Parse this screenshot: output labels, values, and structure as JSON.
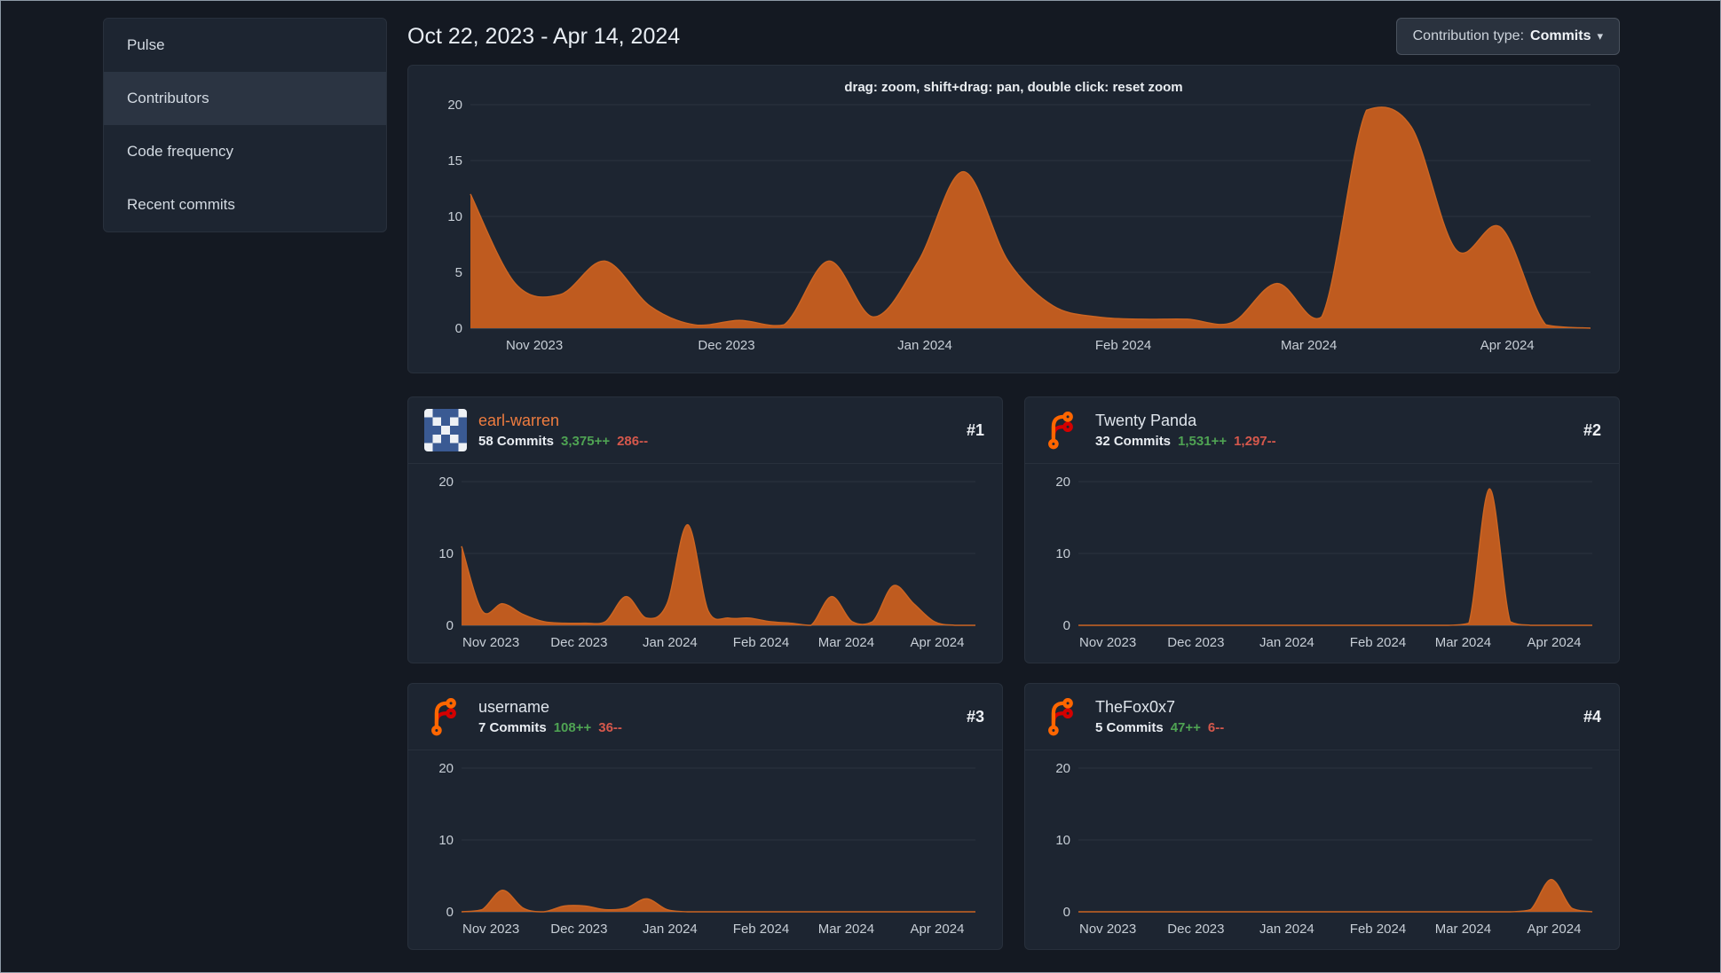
{
  "colors": {
    "chart_fill": "#bf5b1f",
    "additions_green": "#4fa353",
    "deletions_red": "#d5584c",
    "link_orange": "#ee7c3f"
  },
  "sidebar": {
    "active": "Contributors",
    "items": [
      {
        "label": "Pulse"
      },
      {
        "label": "Contributors"
      },
      {
        "label": "Code frequency"
      },
      {
        "label": "Recent commits"
      }
    ]
  },
  "header": {
    "date_range": "Oct 22, 2023 - Apr 14, 2024",
    "contribution_type_label": "Contribution type:",
    "contribution_type_value": "Commits"
  },
  "main_chart": {
    "hint": "drag: zoom, shift+drag: pan, double click: reset zoom"
  },
  "contributors": [
    {
      "name": "earl-warren",
      "name_style": "color:#ee7c3f",
      "rank": "#1",
      "commits": "58 Commits",
      "additions": "3,375++",
      "deletions": "286--",
      "avatar": "identicon"
    },
    {
      "name": "Twenty Panda",
      "rank": "#2",
      "commits": "32 Commits",
      "additions": "1,531++",
      "deletions": "1,297--",
      "avatar": "forgejo-logo"
    },
    {
      "name": "username",
      "rank": "#3",
      "commits": "7 Commits",
      "additions": "108++",
      "deletions": "36--",
      "avatar": "forgejo-logo"
    },
    {
      "name": "TheFox0x7",
      "rank": "#4",
      "commits": "5 Commits",
      "additions": "47++",
      "deletions": "6--",
      "avatar": "forgejo-logo"
    }
  ],
  "chart_data": {
    "type": "area",
    "x_range": [
      "Oct 22, 2023",
      "Apr 14, 2024"
    ],
    "x_interval": "week",
    "x_month_labels": [
      "Nov 2023",
      "Dec 2023",
      "Jan 2024",
      "Feb 2024",
      "Mar 2024",
      "Apr 2024"
    ],
    "ylim": [
      0,
      20
    ],
    "color": "#bf5b1f",
    "main": {
      "yticks": [
        0,
        5,
        10,
        15,
        20
      ],
      "values": [
        12,
        4,
        3,
        6,
        2,
        0.3,
        0.7,
        0.3,
        6,
        1,
        6,
        14,
        6,
        2,
        1,
        0.8,
        0.8,
        0.5,
        4,
        1,
        19.5,
        18,
        7,
        9,
        0.3,
        0
      ]
    },
    "per_contributor": [
      {
        "name": "earl-warren",
        "yticks": [
          0,
          10,
          20
        ],
        "values": [
          11,
          2,
          3,
          1.5,
          0.5,
          0.3,
          0.3,
          0.5,
          4,
          1,
          3,
          14,
          2,
          1,
          1,
          0.5,
          0.3,
          0,
          4,
          0.5,
          0.5,
          5.5,
          3,
          0.5,
          0,
          0
        ]
      },
      {
        "name": "Twenty Panda",
        "yticks": [
          0,
          10,
          20
        ],
        "values": [
          0,
          0,
          0,
          0,
          0,
          0,
          0,
          0,
          0,
          0,
          0,
          0,
          0,
          0,
          0,
          0,
          0,
          0,
          0,
          0.3,
          19,
          0.5,
          0,
          0,
          0,
          0
        ]
      },
      {
        "name": "username",
        "yticks": [
          0,
          10,
          20
        ],
        "values": [
          0,
          0.3,
          3,
          0.5,
          0,
          0.8,
          0.8,
          0.3,
          0.5,
          1.8,
          0.3,
          0,
          0,
          0,
          0,
          0,
          0,
          0,
          0,
          0,
          0,
          0,
          0,
          0,
          0,
          0
        ]
      },
      {
        "name": "TheFox0x7",
        "yticks": [
          0,
          10,
          20
        ],
        "values": [
          0,
          0,
          0,
          0,
          0,
          0,
          0,
          0,
          0,
          0,
          0,
          0,
          0,
          0,
          0,
          0,
          0,
          0,
          0,
          0,
          0,
          0,
          0.3,
          4.5,
          0.5,
          0
        ]
      }
    ]
  }
}
